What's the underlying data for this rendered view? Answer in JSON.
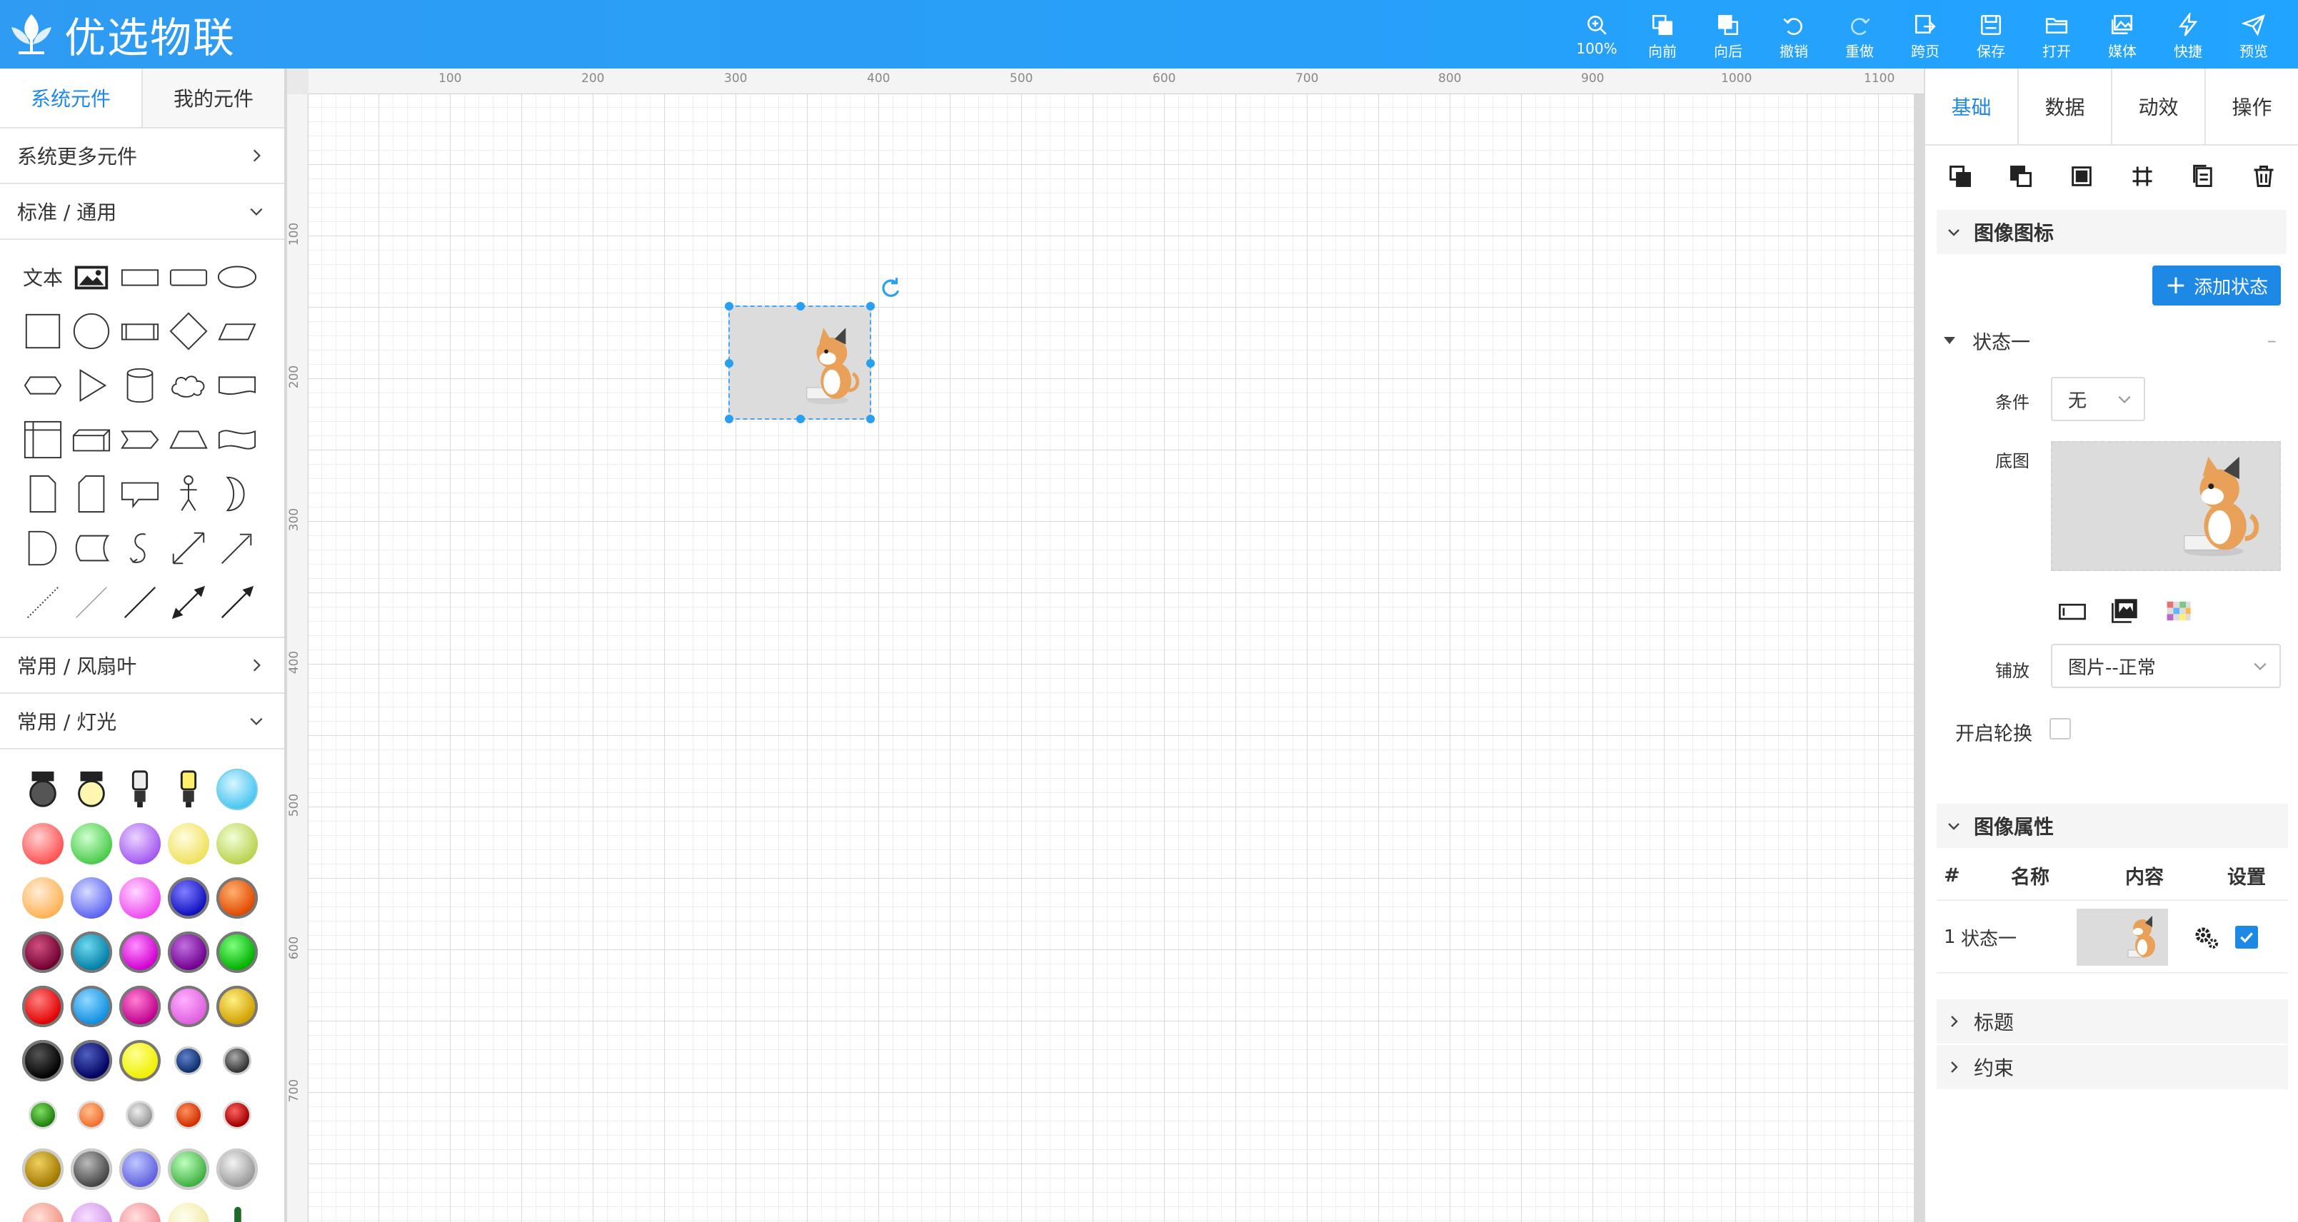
{
  "app": {
    "title": "优选物联"
  },
  "toolbar": [
    {
      "icon": "zoom-in-icon",
      "label": "100%"
    },
    {
      "icon": "bring-forward-icon",
      "label": "向前"
    },
    {
      "icon": "send-backward-icon",
      "label": "向后"
    },
    {
      "icon": "undo-icon",
      "label": "撤销"
    },
    {
      "icon": "redo-icon",
      "label": "重做"
    },
    {
      "icon": "cross-page-icon",
      "label": "跨页"
    },
    {
      "icon": "save-icon",
      "label": "保存"
    },
    {
      "icon": "open-folder-icon",
      "label": "打开"
    },
    {
      "icon": "media-icon",
      "label": "媒体"
    },
    {
      "icon": "lightning-icon",
      "label": "快捷"
    },
    {
      "icon": "send-icon",
      "label": "预览"
    }
  ],
  "left": {
    "tabs": [
      "系统元件",
      "我的元件"
    ],
    "sections": [
      "系统更多元件",
      "标准 / 通用",
      "常用 / 风扇叶",
      "常用 / 灯光"
    ],
    "text_shape": "文本"
  },
  "ruler": {
    "top": [
      "100",
      "200",
      "300",
      "400",
      "500",
      "600",
      "700",
      "800",
      "900",
      "1000",
      "1100"
    ],
    "left": [
      "100",
      "200",
      "300",
      "400",
      "500",
      "600",
      "700"
    ]
  },
  "right": {
    "tabs": [
      "基础",
      "数据",
      "动效",
      "操作"
    ],
    "image_icon_section": "图像图标",
    "add_state": "添加状态",
    "state_name": "状态一",
    "collapse_symbol": "–",
    "condition_label": "条件",
    "condition_value": "无",
    "bg_label": "底图",
    "tile_label": "铺放",
    "tile_value": "图片--正常",
    "carousel_label": "开启轮换",
    "image_props_section": "图像属性",
    "table_headers": [
      "#",
      "名称",
      "内容",
      "设置"
    ],
    "table_rows": [
      {
        "index": "1",
        "name": "状态一"
      }
    ],
    "title_section": "标题",
    "constraint_section": "约束"
  },
  "colors": {
    "header": "#2196f3",
    "accent": "#1e88e5",
    "selection": "#27a0f2"
  }
}
